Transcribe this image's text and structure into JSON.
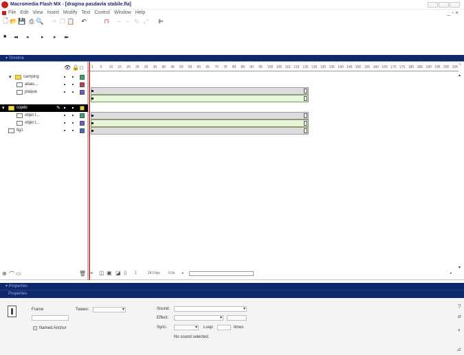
{
  "window": {
    "title": "Macromedia Flash MX - [dragina pasdavla stabile.fla]",
    "accent_color": "#c41f24"
  },
  "menubar": {
    "items": [
      "File",
      "Edit",
      "View",
      "Insert",
      "Modify",
      "Text",
      "Control",
      "Window",
      "Help"
    ],
    "mdi_controls": "_ ▫ ×"
  },
  "toolbar": {
    "icons": [
      "new-file-icon",
      "open-folder-icon",
      "save-icon",
      "print-icon",
      "print-preview-icon",
      "cut-icon",
      "copy-icon",
      "paste-icon",
      "undo-icon",
      "snap-magnet-icon",
      "smooth-icon",
      "straighten-icon",
      "rotate-icon",
      "scale-icon",
      "align-icon"
    ]
  },
  "controller": {
    "buttons": [
      "■",
      "◂◂",
      "◂",
      "▸",
      "▸",
      "▸▸"
    ]
  },
  "timeline": {
    "header_label": "▾ Timeline",
    "column_icons": [
      "👁",
      "🔒",
      "□"
    ],
    "layers": [
      {
        "name": "camping",
        "type": "folder",
        "expanded": true,
        "selected": false,
        "color": "#33aa66"
      },
      {
        "name": "abaic...",
        "type": "layer",
        "indent": true,
        "selected": false,
        "color": "#d23c3c"
      },
      {
        "name": "plaque",
        "type": "layer",
        "indent": true,
        "selected": false,
        "color": "#7c55c8"
      },
      {
        "name": "cojebi",
        "type": "folder",
        "expanded": true,
        "selected": true,
        "color": "#f2d32a"
      },
      {
        "name": "objet t...",
        "type": "layer",
        "indent": true,
        "selected": false,
        "color": "#33aa66"
      },
      {
        "name": "objet t...",
        "type": "layer",
        "indent": true,
        "selected": false,
        "color": "#7c55c8"
      },
      {
        "name": "fig1",
        "type": "layer",
        "indent": false,
        "selected": false,
        "color": "#3a6fd0"
      }
    ],
    "ruler_numbers": [
      "1",
      "5",
      "10",
      "15",
      "20",
      "25",
      "30",
      "35",
      "40",
      "45",
      "50",
      "55",
      "60",
      "65",
      "70",
      "75",
      "80",
      "85",
      "90",
      "95",
      "100",
      "105",
      "110",
      "115",
      "120",
      "125",
      "130",
      "135",
      "140",
      "145",
      "150",
      "155",
      "160",
      "165",
      "170",
      "175",
      "180",
      "185",
      "190",
      "195",
      "200",
      "205"
    ],
    "footer": {
      "fps_text": "24.0 fps",
      "time_text": "0.0s"
    }
  },
  "properties": {
    "header_label": "▾ Properties",
    "sub_label": "Properties",
    "frame_label": "Frame",
    "tween_label": "Tween:",
    "named_anchor_label": "Named Anchor",
    "sound_label": "Sound:",
    "effect_label": "Effect:",
    "sync_label": "Sync:",
    "loop_label": "Loop:",
    "times_label": "times",
    "no_sound_text": "No sound selected."
  }
}
